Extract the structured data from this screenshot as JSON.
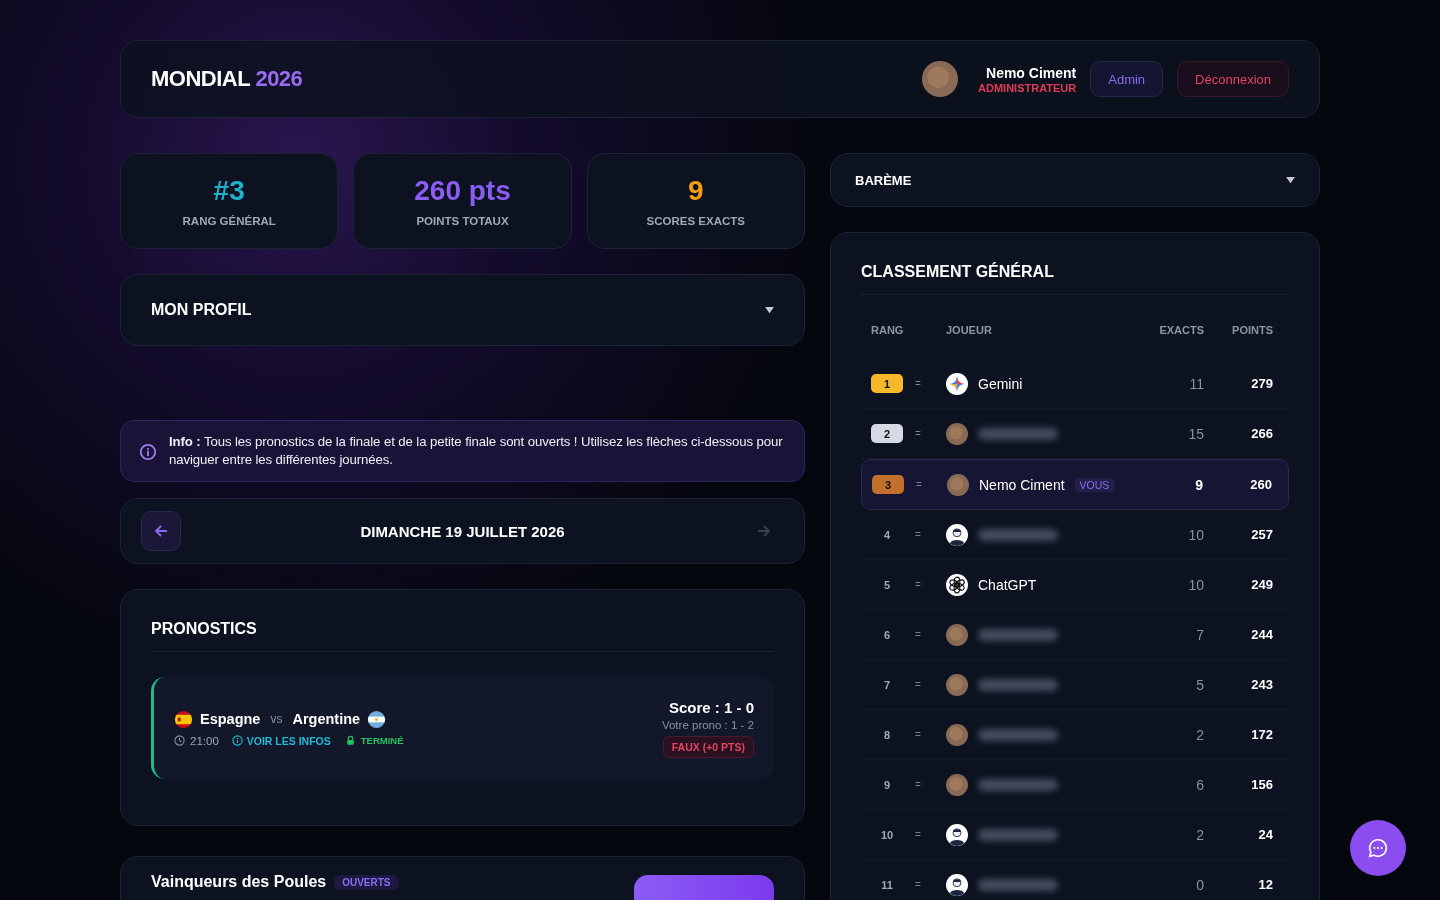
{
  "header": {
    "logo": {
      "text": "MONDIAL",
      "accent": "2026"
    },
    "user": {
      "name": "Nemo Ciment",
      "role": "ADMINISTRATEUR"
    },
    "buttons": [
      {
        "label": "Admin",
        "kind": "admin"
      },
      {
        "label": "Déconnexion",
        "kind": "logout"
      }
    ]
  },
  "stats": [
    {
      "value": "#3",
      "label": "RANG GÉNÉRAL",
      "color": "#1fb0cc"
    },
    {
      "value": "260 pts",
      "label": "POINTS TOTAUX",
      "color": "#8b5cf6"
    },
    {
      "value": "9",
      "label": "SCORES EXACTS",
      "color": "#f59e0b"
    }
  ],
  "profile": {
    "title": "MON PROFIL",
    "expanded": false
  },
  "info": {
    "text": "**Info :** Tous les pronostics de la finale et de la petite finale sont ouverts ! Utilisez les flèches ci-dessous pour naviguer entre les différentes journées."
  },
  "day_nav": {
    "title": "DIMANCHE 19 JUILLET 2026",
    "prev_disabled": false,
    "next_disabled": true
  },
  "predictions": {
    "title": "PRONOSTICS",
    "matches": [
      {
        "home": "Espagne",
        "vs": "vs",
        "away": "Argentine",
        "time": "21:00",
        "info_link": "VOIR LES INFOS",
        "status": "TERMINÉ",
        "score": "Score : 1 - 0",
        "prono": "Votre prono : 1 - 2",
        "result": "FAUX (+0 PTS)",
        "correct": false
      }
    ]
  },
  "group_winners": {
    "title": "Vainqueurs des Poules",
    "badge": "OUVERTS"
  },
  "scale": {
    "title": "BARÈME",
    "expanded": false
  },
  "ranking": {
    "title": "CLASSEMENT GÉNÉRAL",
    "columns": [
      "RANG",
      "JOUEUR",
      "EXACTS",
      "POINTS"
    ],
    "rows": [
      {
        "rank": "1",
        "color": "#f5b82a",
        "trend": "=",
        "kind": "gemini",
        "name": "Gemini",
        "exacts": "11",
        "points": "279",
        "highlighted": false
      },
      {
        "rank": "2",
        "color": "#d4d9e3",
        "trend": "=",
        "kind": "photo",
        "name_hidden": true,
        "exacts": "15",
        "points": "266",
        "highlighted": false
      },
      {
        "rank": "3",
        "color": "#c2702c",
        "trend": "=",
        "kind": "photo",
        "name": "Nemo Ciment",
        "you_badge": "VOUS",
        "exacts": "9",
        "points": "260",
        "highlighted": true
      },
      {
        "rank": "4",
        "trend": "=",
        "kind": "default",
        "name_hidden": true,
        "exacts": "10",
        "points": "257",
        "highlighted": false
      },
      {
        "rank": "5",
        "trend": "=",
        "kind": "chatgpt",
        "name": "ChatGPT",
        "exacts": "10",
        "points": "249",
        "highlighted": false
      },
      {
        "rank": "6",
        "trend": "=",
        "kind": "photo",
        "name_hidden": true,
        "exacts": "7",
        "points": "244",
        "highlighted": false
      },
      {
        "rank": "7",
        "trend": "=",
        "kind": "photo",
        "name_hidden": true,
        "exacts": "5",
        "points": "243",
        "highlighted": false
      },
      {
        "rank": "8",
        "trend": "=",
        "kind": "photo",
        "name_hidden": true,
        "exacts": "2",
        "points": "172",
        "highlighted": false
      },
      {
        "rank": "9",
        "trend": "=",
        "kind": "photo",
        "name_hidden": true,
        "exacts": "6",
        "points": "156",
        "highlighted": false
      },
      {
        "rank": "10",
        "trend": "=",
        "kind": "default",
        "name_hidden": true,
        "exacts": "2",
        "points": "24",
        "highlighted": false
      },
      {
        "rank": "11",
        "trend": "=",
        "kind": "default",
        "name_hidden": true,
        "exacts": "0",
        "points": "12",
        "highlighted": false
      }
    ]
  }
}
